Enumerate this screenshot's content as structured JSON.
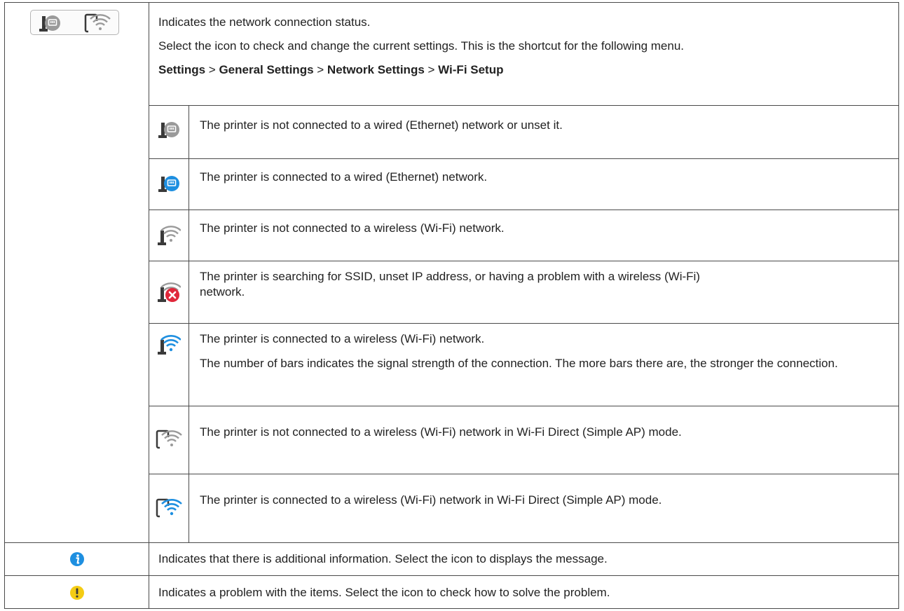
{
  "network": {
    "line1": "Indicates the network connection status.",
    "line2": "Select the icon to check and change the current settings. This is the shortcut for the following menu.",
    "path": {
      "settings": "Settings",
      "sep": " > ",
      "general": "General Settings",
      "network": "Network Settings",
      "wifi": "Wi-Fi Setup"
    },
    "states": [
      {
        "icon": "ethernet-disconnected-icon",
        "lines": [
          "The printer is not connected to a wired (Ethernet) network or unset it."
        ]
      },
      {
        "icon": "ethernet-connected-icon",
        "lines": [
          "The printer is connected to a wired (Ethernet) network."
        ]
      },
      {
        "icon": "wifi-disconnected-icon",
        "lines": [
          "The printer is not connected to a wireless (Wi-Fi) network."
        ]
      },
      {
        "icon": "wifi-error-icon",
        "lines": [
          "The printer is searching for SSID, unset IP address, or having a problem with a wireless (Wi-Fi) network."
        ]
      },
      {
        "icon": "wifi-connected-icon",
        "lines": [
          "The printer is connected to a wireless (Wi-Fi) network.",
          "The number of bars indicates the signal strength of the connection. The more bars there are, the stronger the connection."
        ]
      },
      {
        "icon": "wifi-direct-disconnected-icon",
        "lines": [
          "The printer is not connected to a wireless (Wi-Fi) network in Wi-Fi Direct (Simple AP) mode."
        ]
      },
      {
        "icon": "wifi-direct-connected-icon",
        "lines": [
          "The printer is connected to a wireless (Wi-Fi) network in Wi-Fi Direct (Simple AP) mode."
        ]
      }
    ]
  },
  "info": {
    "icon": "info-icon",
    "text": "Indicates that there is additional information. Select the icon to displays the message."
  },
  "warning": {
    "icon": "warning-icon",
    "text": "Indicates a problem with the items. Select the icon to check how to solve the problem."
  },
  "colors": {
    "blue": "#1e8fe0",
    "gray": "#9a9a9a",
    "dark": "#3a3a3a",
    "red": "#e0273a",
    "yellow": "#f4cc14"
  }
}
